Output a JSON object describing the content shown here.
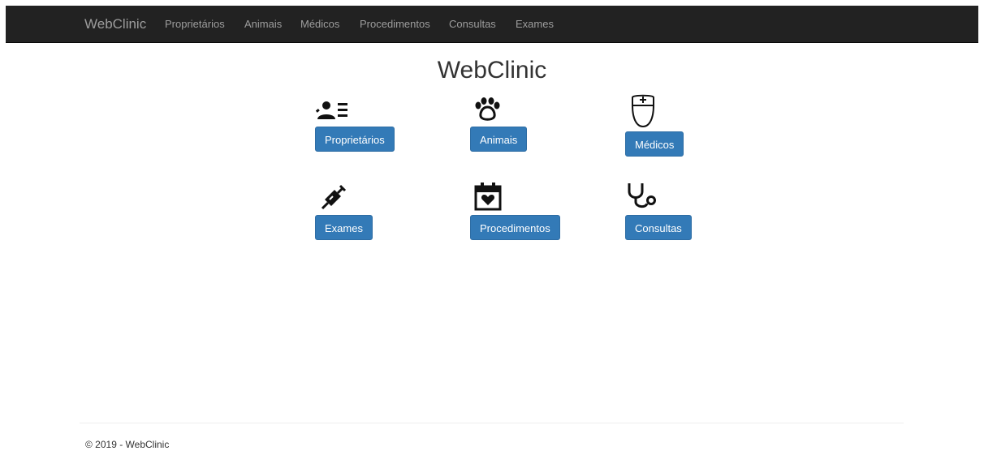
{
  "navbar": {
    "brand": "WebClinic",
    "items": [
      "Proprietários",
      "Animais",
      "Médicos",
      "Procedimentos",
      "Consultas",
      "Exames"
    ]
  },
  "main": {
    "title": "WebClinic",
    "tiles": [
      {
        "label": "Proprietários",
        "icon": "owners-list-icon"
      },
      {
        "label": "Animais",
        "icon": "paw-icon"
      },
      {
        "label": "Médicos",
        "icon": "doctor-icon"
      },
      {
        "label": "Exames",
        "icon": "syringe-icon"
      },
      {
        "label": "Procedimentos",
        "icon": "calendar-heart-icon"
      },
      {
        "label": "Consultas",
        "icon": "stethoscope-icon"
      }
    ]
  },
  "footer": {
    "text": "© 2019 - WebClinic"
  },
  "colors": {
    "navbar_bg": "#222222",
    "nav_text": "#9d9d9d",
    "button_bg": "#337ab7",
    "button_border": "#2e6da4"
  }
}
